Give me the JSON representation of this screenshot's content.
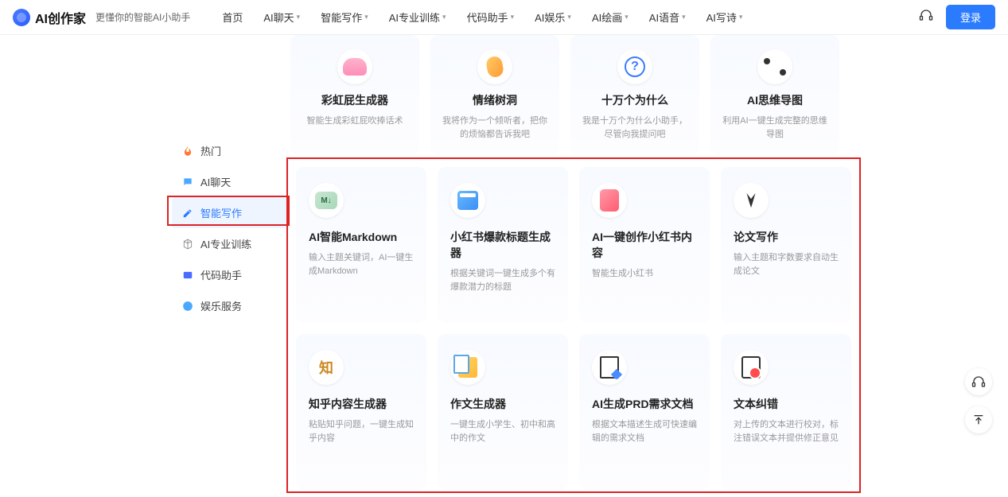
{
  "header": {
    "logo_text": "AI创作家",
    "tagline": "更懂你的智能AI小助手",
    "nav": [
      "首页",
      "AI聊天",
      "智能写作",
      "AI专业训练",
      "代码助手",
      "AI娱乐",
      "AI绘画",
      "AI语音",
      "AI写诗"
    ],
    "nav_has_dropdown": [
      false,
      true,
      true,
      true,
      true,
      true,
      true,
      true,
      true
    ],
    "login": "登录"
  },
  "sidebar": {
    "items": [
      {
        "label": "热门",
        "icon": "fire"
      },
      {
        "label": "AI聊天",
        "icon": "chat"
      },
      {
        "label": "智能写作",
        "icon": "edit",
        "active": true
      },
      {
        "label": "AI专业训练",
        "icon": "cube"
      },
      {
        "label": "代码助手",
        "icon": "code"
      },
      {
        "label": "娱乐服务",
        "icon": "smile"
      }
    ]
  },
  "cards_top": [
    {
      "title": "彩虹屁生成器",
      "desc": "智能生成彩虹屁吹捧话术"
    },
    {
      "title": "情绪树洞",
      "desc": "我将作为一个倾听者，把你的烦恼都告诉我吧"
    },
    {
      "title": "十万个为什么",
      "desc": "我是十万个为什么小助手，尽管向我提问吧"
    },
    {
      "title": "AI思维导图",
      "desc": "利用AI一键生成完整的思维导图"
    }
  ],
  "cards_grid": [
    {
      "title": "AI智能Markdown",
      "desc": "输入主题关键词，AI一键生成Markdown"
    },
    {
      "title": "小红书爆款标题生成器",
      "desc": "根据关键词一键生成多个有爆款潜力的标题"
    },
    {
      "title": "AI一键创作小红书内容",
      "desc": "智能生成小红书"
    },
    {
      "title": "论文写作",
      "desc": "输入主题和字数要求自动生成论文"
    },
    {
      "title": "知乎内容生成器",
      "desc": "粘贴知乎问题，一键生成知乎内容"
    },
    {
      "title": "作文生成器",
      "desc": "一键生成小学生、初中和高中的作文"
    },
    {
      "title": "AI生成PRD需求文档",
      "desc": "根据文本描述生成可快速编辑的需求文档"
    },
    {
      "title": "文本纠错",
      "desc": "对上传的文本进行校对，标注错误文本并提供修正意见"
    }
  ]
}
